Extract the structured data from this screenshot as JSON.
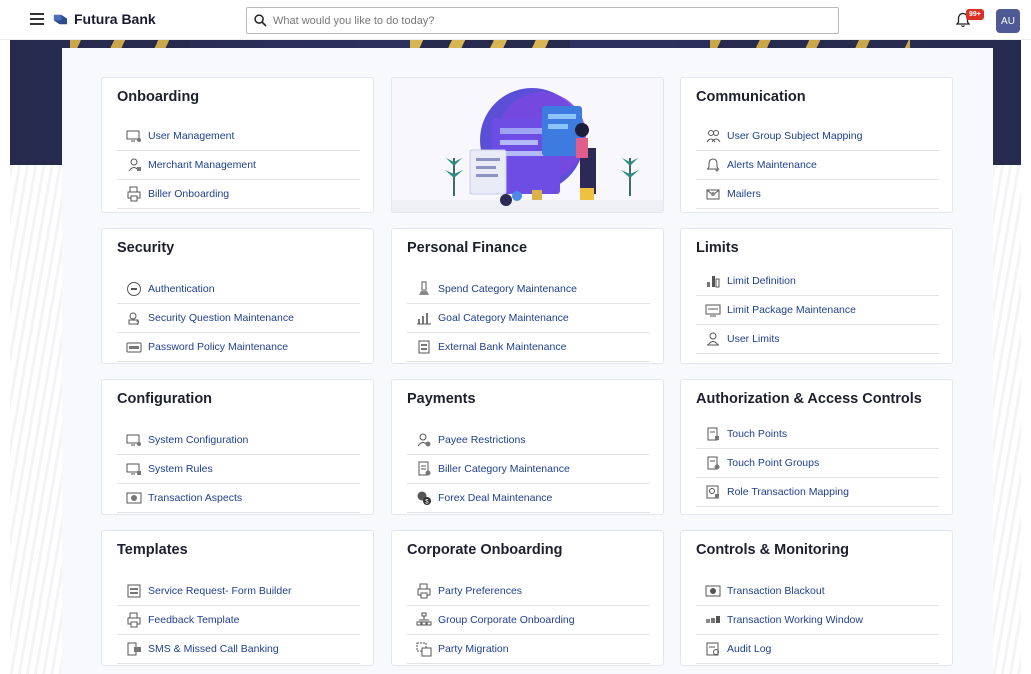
{
  "header": {
    "brand": "Futura Bank",
    "search_placeholder": "What would you like to do today?",
    "notification_badge": "99+",
    "avatar_initials": "AU"
  },
  "colors": {
    "link": "#1f3f8f",
    "title": "#1d1f2e",
    "banner": "#2a2e58",
    "badge": "#d93025",
    "avatar": "#4e5a96"
  },
  "cards": {
    "onboarding": {
      "title": "Onboarding",
      "items": [
        {
          "label": "User Management",
          "icon": "monitor-user-icon"
        },
        {
          "label": "Merchant Management",
          "icon": "merchant-icon"
        },
        {
          "label": "Biller Onboarding",
          "icon": "printer-icon"
        }
      ]
    },
    "communication": {
      "title": "Communication",
      "items": [
        {
          "label": "User Group Subject Mapping",
          "icon": "user-group-icon"
        },
        {
          "label": "Alerts Maintenance",
          "icon": "bell-icon"
        },
        {
          "label": "Mailers",
          "icon": "mailer-icon"
        }
      ]
    },
    "security": {
      "title": "Security",
      "items": [
        {
          "label": "Authentication",
          "icon": "shield-icon"
        },
        {
          "label": "Security Question Maintenance",
          "icon": "question-icon"
        },
        {
          "label": "Password Policy Maintenance",
          "icon": "password-icon"
        }
      ]
    },
    "personal_finance": {
      "title": "Personal Finance",
      "items": [
        {
          "label": "Spend Category Maintenance",
          "icon": "spend-icon"
        },
        {
          "label": "Goal Category Maintenance",
          "icon": "goal-icon"
        },
        {
          "label": "External Bank Maintenance",
          "icon": "bank-icon"
        }
      ]
    },
    "limits": {
      "title": "Limits",
      "items": [
        {
          "label": "Limit Definition",
          "icon": "limit-chart-icon"
        },
        {
          "label": "Limit Package Maintenance",
          "icon": "package-icon"
        },
        {
          "label": "User Limits",
          "icon": "user-limit-icon"
        }
      ]
    },
    "configuration": {
      "title": "Configuration",
      "items": [
        {
          "label": "System Configuration",
          "icon": "monitor-config-icon"
        },
        {
          "label": "System Rules",
          "icon": "monitor-rules-icon"
        },
        {
          "label": "Transaction Aspects",
          "icon": "transaction-icon"
        }
      ]
    },
    "payments": {
      "title": "Payments",
      "items": [
        {
          "label": "Payee Restrictions",
          "icon": "payee-icon"
        },
        {
          "label": "Biller Category Maintenance",
          "icon": "biller-category-icon"
        },
        {
          "label": "Forex Deal Maintenance",
          "icon": "forex-icon"
        }
      ]
    },
    "authorization": {
      "title": "Authorization & Access Controls",
      "items": [
        {
          "label": "Touch Points",
          "icon": "touch-point-icon"
        },
        {
          "label": "Touch Point Groups",
          "icon": "touch-group-icon"
        },
        {
          "label": "Role Transaction Mapping",
          "icon": "role-mapping-icon"
        }
      ]
    },
    "templates": {
      "title": "Templates",
      "items": [
        {
          "label": "Service Request- Form Builder",
          "icon": "form-builder-icon"
        },
        {
          "label": "Feedback Template",
          "icon": "feedback-icon"
        },
        {
          "label": "SMS & Missed Call Banking",
          "icon": "sms-icon"
        }
      ]
    },
    "corporate_onboarding": {
      "title": "Corporate Onboarding",
      "items": [
        {
          "label": "Party Preferences",
          "icon": "party-pref-icon"
        },
        {
          "label": "Group Corporate Onboarding",
          "icon": "org-chart-icon"
        },
        {
          "label": "Party Migration",
          "icon": "migration-icon"
        }
      ]
    },
    "controls_monitoring": {
      "title": "Controls & Monitoring",
      "items": [
        {
          "label": "Transaction Blackout",
          "icon": "blackout-icon"
        },
        {
          "label": "Transaction Working Window",
          "icon": "working-window-icon"
        },
        {
          "label": "Audit Log",
          "icon": "audit-log-icon"
        }
      ]
    }
  }
}
